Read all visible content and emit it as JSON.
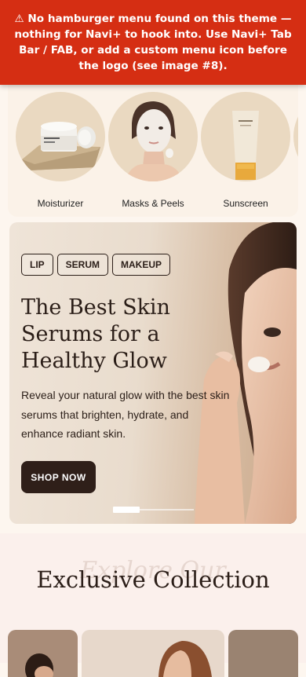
{
  "warning": {
    "text": "⚠ No hamburger menu found on this theme — nothing for Navi+ to hook into. Use Navi+ Tab Bar / FAB, or add a custom menu icon before the logo (see image #8)."
  },
  "categories": [
    {
      "label": "Moisturizer",
      "image": "moisturizer-jar"
    },
    {
      "label": "Masks & Peels",
      "image": "face-mask-model"
    },
    {
      "label": "Sunscreen",
      "image": "sunscreen-tube"
    }
  ],
  "hero": {
    "tags": [
      "LIP",
      "SERUM",
      "MAKEUP"
    ],
    "title": "The Best Skin Serums for a Healthy Glow",
    "description": "Reveal your natural glow with the best skin serums that brighten, hydrate, and enhance radiant skin.",
    "cta": "SHOP NOW",
    "slide_progress": 0.33
  },
  "collection": {
    "script_text": "Explore Our",
    "heading": "Exclusive Collection"
  }
}
